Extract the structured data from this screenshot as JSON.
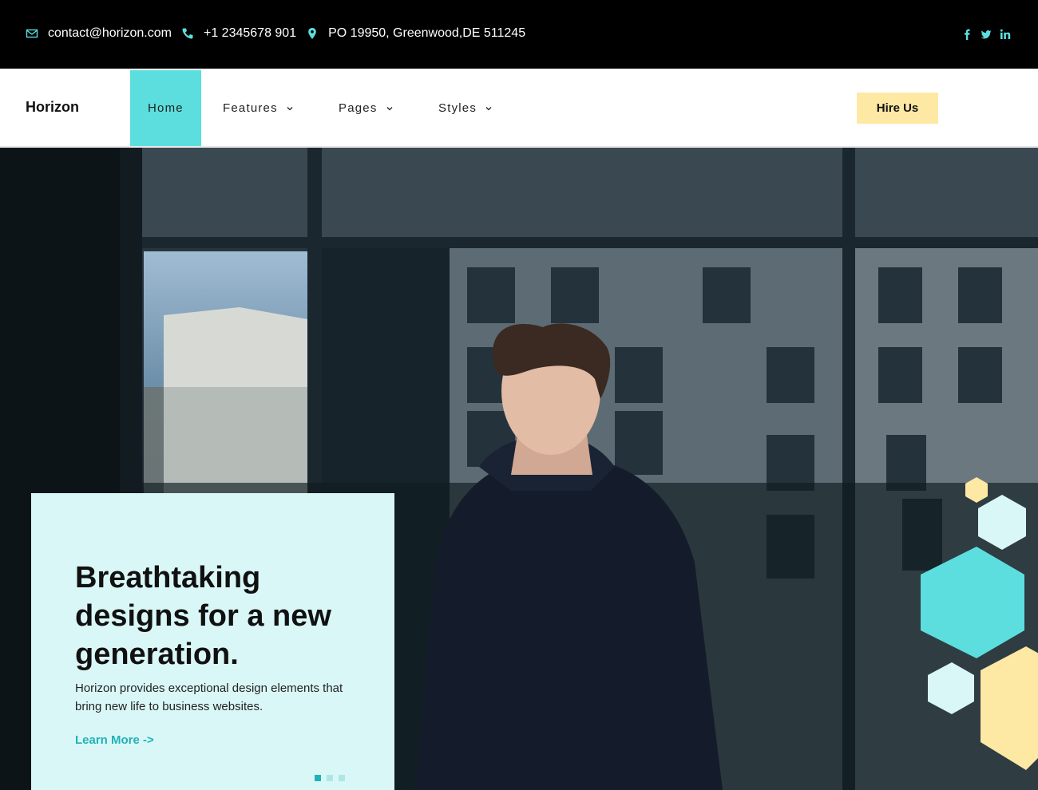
{
  "topbar": {
    "email": "contact@horizon.com",
    "phone": "+1 2345678 901",
    "address": "PO 19950, Greenwood,DE 511245",
    "icons": {
      "email": "envelope-icon",
      "phone": "phone-icon",
      "address": "map-marker-icon"
    },
    "social": [
      "facebook-icon",
      "twitter-icon",
      "linkedin-icon"
    ]
  },
  "navbar": {
    "logo": "Horizon",
    "items": [
      {
        "label": "Home",
        "active": true
      },
      {
        "label": "Features",
        "dropdown": true
      },
      {
        "label": "Pages",
        "dropdown": true
      },
      {
        "label": "Styles",
        "dropdown": true
      }
    ],
    "cta": "Hire Us"
  },
  "hero": {
    "title": "Breathtaking designs for a new generation.",
    "description": "Horizon provides exceptional design elements that bring new life to business websites.",
    "link": "Learn More ->",
    "slides": 3,
    "active_slide": 1
  },
  "colors": {
    "accent": "#5cdede",
    "accent_dark": "#21b2b6",
    "card_bg": "#daf7f7",
    "button_bg": "#fde8a4",
    "topbar_bg": "#000000"
  }
}
